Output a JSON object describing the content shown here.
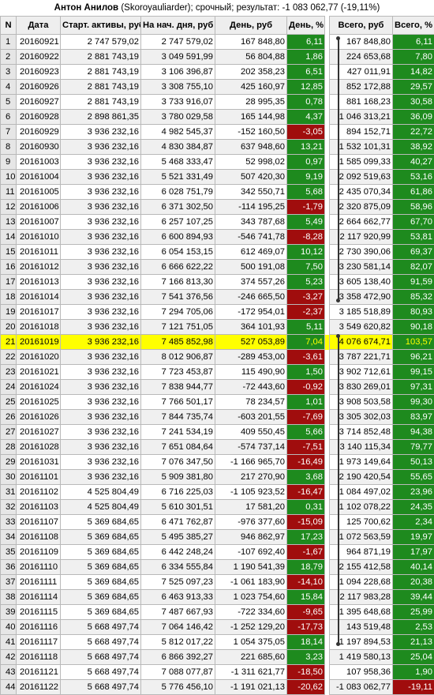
{
  "title": {
    "name": "Антон Анилов",
    "rest": "(Skoroyauliarder); срочный; результат: -1 083 062,77 (-19,11%)"
  },
  "columns": [
    "N",
    "Дата",
    "Старт. активы, руб",
    "На нач. дня, руб",
    "День, руб",
    "День, %",
    "Всего, руб",
    "Всего, %"
  ],
  "highlight_row": 21,
  "rows": [
    {
      "n": "1",
      "date": "20160921",
      "start": "2 747 579,02",
      "begin": "2 747 579,02",
      "day": "167 848,80",
      "dayp": "6,11",
      "total": "167 848,80",
      "totalp": "6,11"
    },
    {
      "n": "2",
      "date": "20160922",
      "start": "2 881 743,19",
      "begin": "3 049 591,99",
      "day": "56 804,88",
      "dayp": "1,86",
      "total": "224 653,68",
      "totalp": "7,80"
    },
    {
      "n": "3",
      "date": "20160923",
      "start": "2 881 743,19",
      "begin": "3 106 396,87",
      "day": "202 358,23",
      "dayp": "6,51",
      "total": "427 011,91",
      "totalp": "14,82"
    },
    {
      "n": "4",
      "date": "20160926",
      "start": "2 881 743,19",
      "begin": "3 308 755,10",
      "day": "425 160,97",
      "dayp": "12,85",
      "total": "852 172,88",
      "totalp": "29,57"
    },
    {
      "n": "5",
      "date": "20160927",
      "start": "2 881 743,19",
      "begin": "3 733 916,07",
      "day": "28 995,35",
      "dayp": "0,78",
      "total": "881 168,23",
      "totalp": "30,58"
    },
    {
      "n": "6",
      "date": "20160928",
      "start": "2 898 861,35",
      "begin": "3 780 029,58",
      "day": "165 144,98",
      "dayp": "4,37",
      "total": "1 046 313,21",
      "totalp": "36,09"
    },
    {
      "n": "7",
      "date": "20160929",
      "start": "3 936 232,16",
      "begin": "4 982 545,37",
      "day": "-152 160,50",
      "dayp": "-3,05",
      "total": "894 152,71",
      "totalp": "22,72"
    },
    {
      "n": "8",
      "date": "20160930",
      "start": "3 936 232,16",
      "begin": "4 830 384,87",
      "day": "637 948,60",
      "dayp": "13,21",
      "total": "1 532 101,31",
      "totalp": "38,92"
    },
    {
      "n": "9",
      "date": "20161003",
      "start": "3 936 232,16",
      "begin": "5 468 333,47",
      "day": "52 998,02",
      "dayp": "0,97",
      "total": "1 585 099,33",
      "totalp": "40,27"
    },
    {
      "n": "10",
      "date": "20161004",
      "start": "3 936 232,16",
      "begin": "5 521 331,49",
      "day": "507 420,30",
      "dayp": "9,19",
      "total": "2 092 519,63",
      "totalp": "53,16"
    },
    {
      "n": "11",
      "date": "20161005",
      "start": "3 936 232,16",
      "begin": "6 028 751,79",
      "day": "342 550,71",
      "dayp": "5,68",
      "total": "2 435 070,34",
      "totalp": "61,86"
    },
    {
      "n": "12",
      "date": "20161006",
      "start": "3 936 232,16",
      "begin": "6 371 302,50",
      "day": "-114 195,25",
      "dayp": "-1,79",
      "total": "2 320 875,09",
      "totalp": "58,96"
    },
    {
      "n": "13",
      "date": "20161007",
      "start": "3 936 232,16",
      "begin": "6 257 107,25",
      "day": "343 787,68",
      "dayp": "5,49",
      "total": "2 664 662,77",
      "totalp": "67,70"
    },
    {
      "n": "14",
      "date": "20161010",
      "start": "3 936 232,16",
      "begin": "6 600 894,93",
      "day": "-546 741,78",
      "dayp": "-8,28",
      "total": "2 117 920,99",
      "totalp": "53,81"
    },
    {
      "n": "15",
      "date": "20161011",
      "start": "3 936 232,16",
      "begin": "6 054 153,15",
      "day": "612 469,07",
      "dayp": "10,12",
      "total": "2 730 390,06",
      "totalp": "69,37"
    },
    {
      "n": "16",
      "date": "20161012",
      "start": "3 936 232,16",
      "begin": "6 666 622,22",
      "day": "500 191,08",
      "dayp": "7,50",
      "total": "3 230 581,14",
      "totalp": "82,07"
    },
    {
      "n": "17",
      "date": "20161013",
      "start": "3 936 232,16",
      "begin": "7 166 813,30",
      "day": "374 557,26",
      "dayp": "5,23",
      "total": "3 605 138,40",
      "totalp": "91,59"
    },
    {
      "n": "18",
      "date": "20161014",
      "start": "3 936 232,16",
      "begin": "7 541 376,56",
      "day": "-246 665,50",
      "dayp": "-3,27",
      "total": "3 358 472,90",
      "totalp": "85,32"
    },
    {
      "n": "19",
      "date": "20161017",
      "start": "3 936 232,16",
      "begin": "7 294 705,06",
      "day": "-172 954,01",
      "dayp": "-2,37",
      "total": "3 185 518,89",
      "totalp": "80,93"
    },
    {
      "n": "20",
      "date": "20161018",
      "start": "3 936 232,16",
      "begin": "7 121 751,05",
      "day": "364 101,93",
      "dayp": "5,11",
      "total": "3 549 620,82",
      "totalp": "90,18"
    },
    {
      "n": "21",
      "date": "20161019",
      "start": "3 936 232,16",
      "begin": "7 485 852,98",
      "day": "527 053,89",
      "dayp": "7,04",
      "total": "4 076 674,71",
      "totalp": "103,57"
    },
    {
      "n": "22",
      "date": "20161020",
      "start": "3 936 232,16",
      "begin": "8 012 906,87",
      "day": "-289 453,00",
      "dayp": "-3,61",
      "total": "3 787 221,71",
      "totalp": "96,21"
    },
    {
      "n": "23",
      "date": "20161021",
      "start": "3 936 232,16",
      "begin": "7 723 453,87",
      "day": "115 490,90",
      "dayp": "1,50",
      "total": "3 902 712,61",
      "totalp": "99,15"
    },
    {
      "n": "24",
      "date": "20161024",
      "start": "3 936 232,16",
      "begin": "7 838 944,77",
      "day": "-72 443,60",
      "dayp": "-0,92",
      "total": "3 830 269,01",
      "totalp": "97,31"
    },
    {
      "n": "25",
      "date": "20161025",
      "start": "3 936 232,16",
      "begin": "7 766 501,17",
      "day": "78 234,57",
      "dayp": "1,01",
      "total": "3 908 503,58",
      "totalp": "99,30"
    },
    {
      "n": "26",
      "date": "20161026",
      "start": "3 936 232,16",
      "begin": "7 844 735,74",
      "day": "-603 201,55",
      "dayp": "-7,69",
      "total": "3 305 302,03",
      "totalp": "83,97"
    },
    {
      "n": "27",
      "date": "20161027",
      "start": "3 936 232,16",
      "begin": "7 241 534,19",
      "day": "409 550,45",
      "dayp": "5,66",
      "total": "3 714 852,48",
      "totalp": "94,38"
    },
    {
      "n": "28",
      "date": "20161028",
      "start": "3 936 232,16",
      "begin": "7 651 084,64",
      "day": "-574 737,14",
      "dayp": "-7,51",
      "total": "3 140 115,34",
      "totalp": "79,77"
    },
    {
      "n": "29",
      "date": "20161031",
      "start": "3 936 232,16",
      "begin": "7 076 347,50",
      "day": "-1 166 965,70",
      "dayp": "-16,49",
      "total": "1 973 149,64",
      "totalp": "50,13"
    },
    {
      "n": "30",
      "date": "20161101",
      "start": "3 936 232,16",
      "begin": "5 909 381,80",
      "day": "217 270,90",
      "dayp": "3,68",
      "total": "2 190 420,54",
      "totalp": "55,65"
    },
    {
      "n": "31",
      "date": "20161102",
      "start": "4 525 804,49",
      "begin": "6 716 225,03",
      "day": "-1 105 923,52",
      "dayp": "-16,47",
      "total": "1 084 497,02",
      "totalp": "23,96"
    },
    {
      "n": "32",
      "date": "20161103",
      "start": "4 525 804,49",
      "begin": "5 610 301,51",
      "day": "17 581,20",
      "dayp": "0,31",
      "total": "1 102 078,22",
      "totalp": "24,35"
    },
    {
      "n": "33",
      "date": "20161107",
      "start": "5 369 684,65",
      "begin": "6 471 762,87",
      "day": "-976 377,60",
      "dayp": "-15,09",
      "total": "125 700,62",
      "totalp": "2,34"
    },
    {
      "n": "34",
      "date": "20161108",
      "start": "5 369 684,65",
      "begin": "5 495 385,27",
      "day": "946 862,97",
      "dayp": "17,23",
      "total": "1 072 563,59",
      "totalp": "19,97"
    },
    {
      "n": "35",
      "date": "20161109",
      "start": "5 369 684,65",
      "begin": "6 442 248,24",
      "day": "-107 692,40",
      "dayp": "-1,67",
      "total": "964 871,19",
      "totalp": "17,97"
    },
    {
      "n": "36",
      "date": "20161110",
      "start": "5 369 684,65",
      "begin": "6 334 555,84",
      "day": "1 190 541,39",
      "dayp": "18,79",
      "total": "2 155 412,58",
      "totalp": "40,14"
    },
    {
      "n": "37",
      "date": "20161111",
      "start": "5 369 684,65",
      "begin": "7 525 097,23",
      "day": "-1 061 183,90",
      "dayp": "-14,10",
      "total": "1 094 228,68",
      "totalp": "20,38"
    },
    {
      "n": "38",
      "date": "20161114",
      "start": "5 369 684,65",
      "begin": "6 463 913,33",
      "day": "1 023 754,60",
      "dayp": "15,84",
      "total": "2 117 983,28",
      "totalp": "39,44"
    },
    {
      "n": "39",
      "date": "20161115",
      "start": "5 369 684,65",
      "begin": "7 487 667,93",
      "day": "-722 334,60",
      "dayp": "-9,65",
      "total": "1 395 648,68",
      "totalp": "25,99"
    },
    {
      "n": "40",
      "date": "20161116",
      "start": "5 668 497,74",
      "begin": "7 064 146,42",
      "day": "-1 252 129,20",
      "dayp": "-17,73",
      "total": "143 519,48",
      "totalp": "2,53"
    },
    {
      "n": "41",
      "date": "20161117",
      "start": "5 668 497,74",
      "begin": "5 812 017,22",
      "day": "1 054 375,05",
      "dayp": "18,14",
      "total": "1 197 894,53",
      "totalp": "21,13"
    },
    {
      "n": "42",
      "date": "20161118",
      "start": "5 668 497,74",
      "begin": "6 866 392,27",
      "day": "221 685,60",
      "dayp": "3,23",
      "total": "1 419 580,13",
      "totalp": "25,04"
    },
    {
      "n": "43",
      "date": "20161121",
      "start": "5 668 497,74",
      "begin": "7 088 077,87",
      "day": "-1 311 621,77",
      "dayp": "-18,50",
      "total": "107 958,36",
      "totalp": "1,90"
    },
    {
      "n": "44",
      "date": "20161122",
      "start": "5 668 497,74",
      "begin": "5 776 456,10",
      "day": "-1 191 021,13",
      "dayp": "-20,62",
      "total": "-1 083 062,77",
      "totalp": "-19,11"
    }
  ]
}
